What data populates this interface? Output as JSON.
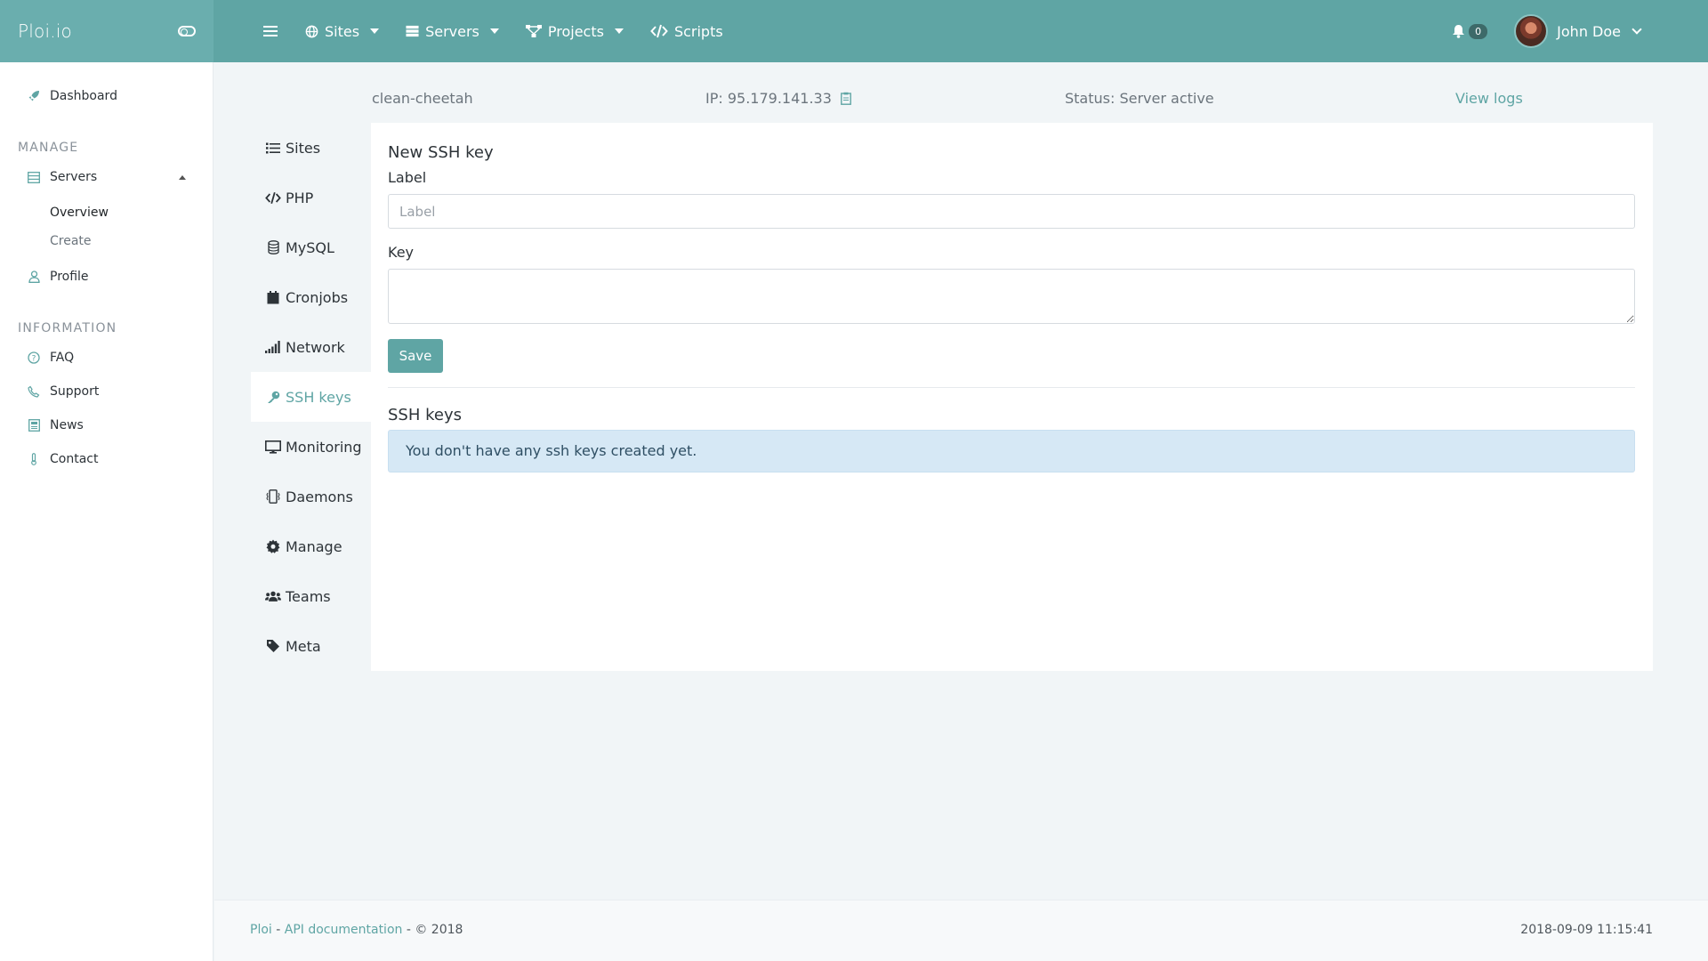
{
  "brand": {
    "name": "Ploi.io"
  },
  "topnav": {
    "items": [
      {
        "label": "Sites",
        "dropdown": true
      },
      {
        "label": "Servers",
        "dropdown": true
      },
      {
        "label": "Projects",
        "dropdown": true
      },
      {
        "label": "Scripts",
        "dropdown": false
      }
    ],
    "notifications_count": "0",
    "user_name": "John Doe"
  },
  "sidebar": {
    "dashboard": "Dashboard",
    "manage_heading": "MANAGE",
    "servers": "Servers",
    "servers_sub": [
      "Overview",
      "Create"
    ],
    "profile": "Profile",
    "information_heading": "INFORMATION",
    "info_items": [
      "FAQ",
      "Support",
      "News",
      "Contact"
    ]
  },
  "server": {
    "name": "clean-cheetah",
    "ip": "IP: 95.179.141.33",
    "status": "Status: Server active",
    "view_logs": "View logs"
  },
  "server_nav": {
    "items": [
      "Sites",
      "PHP",
      "MySQL",
      "Cronjobs",
      "Network",
      "SSH keys",
      "Monitoring",
      "Daemons",
      "Manage",
      "Teams",
      "Meta"
    ],
    "active": "SSH keys"
  },
  "form": {
    "title": "New SSH key",
    "label_field_label": "Label",
    "label_placeholder": "Label",
    "key_field_label": "Key",
    "save_label": "Save"
  },
  "keys_section": {
    "title": "SSH keys",
    "empty_message": "You don't have any ssh keys created yet."
  },
  "footer": {
    "brand_link": "Ploi",
    "sep1": " - ",
    "api_link": "API documentation",
    "copyright": " - © 2018",
    "timestamp": "2018-09-09 11:15:41"
  },
  "colors": {
    "accent": "#5fa5a4",
    "topbar": "#5fa5a4",
    "alert_bg": "#d6e8f5"
  }
}
